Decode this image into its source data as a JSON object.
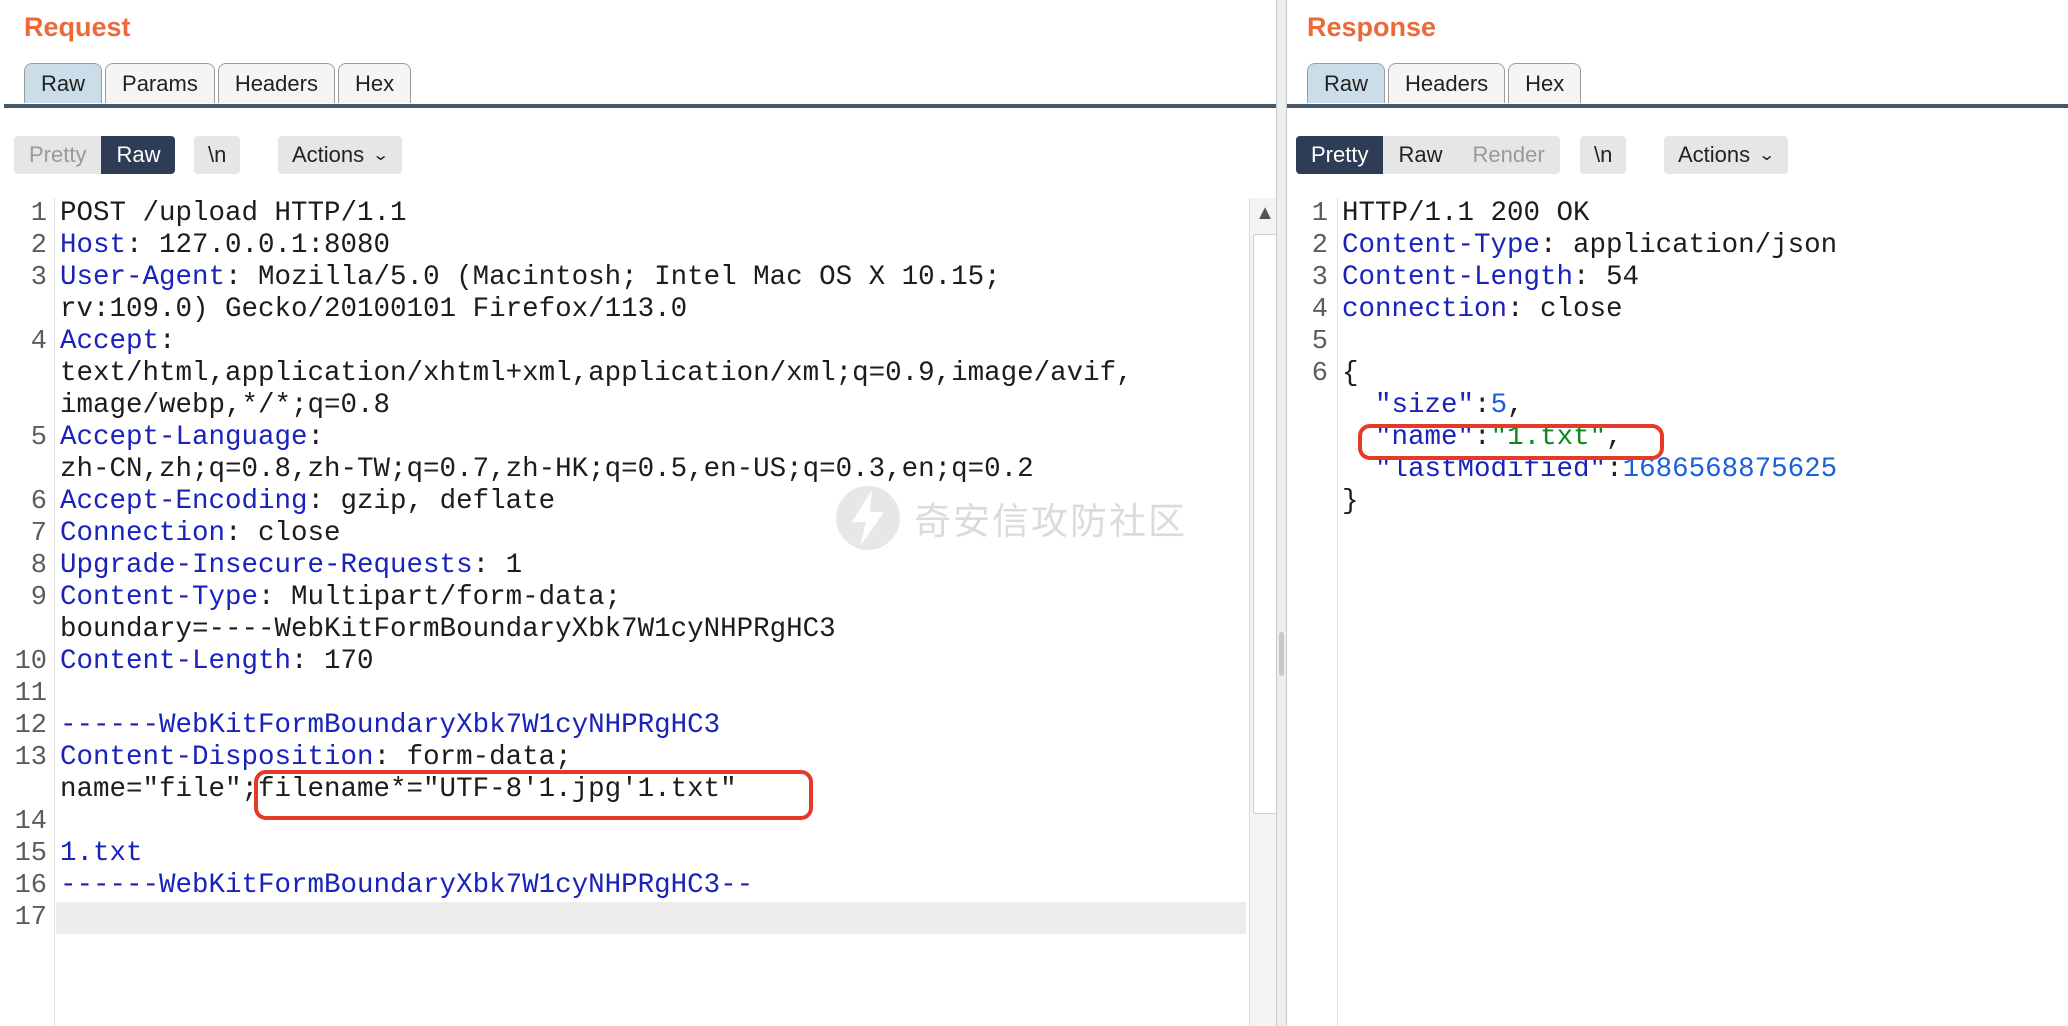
{
  "request": {
    "title": "Request",
    "tabs": [
      {
        "label": "Raw",
        "active": true
      },
      {
        "label": "Params",
        "active": false
      },
      {
        "label": "Headers",
        "active": false
      },
      {
        "label": "Hex",
        "active": false
      }
    ],
    "toolbar": {
      "pretty_label": "Pretty",
      "raw_label": "Raw",
      "active_view": "Raw",
      "newline_label": "\\n",
      "actions_label": "Actions"
    },
    "lines": [
      {
        "n": "1",
        "segments": [
          {
            "t": "POST /upload HTTP/1.1",
            "c": ""
          }
        ]
      },
      {
        "n": "2",
        "segments": [
          {
            "t": "Host",
            "c": "k"
          },
          {
            "t": ": 127.0.0.1:8080",
            "c": ""
          }
        ]
      },
      {
        "n": "3",
        "segments": [
          {
            "t": "User-Agent",
            "c": "k"
          },
          {
            "t": ": Mozilla/5.0 (Macintosh; Intel Mac OS X 10.15;",
            "c": ""
          }
        ]
      },
      {
        "n": "",
        "segments": [
          {
            "t": "rv:109.0) Gecko/20100101 Firefox/113.0",
            "c": ""
          }
        ]
      },
      {
        "n": "4",
        "segments": [
          {
            "t": "Accept",
            "c": "k"
          },
          {
            "t": ":",
            "c": ""
          }
        ]
      },
      {
        "n": "",
        "segments": [
          {
            "t": "text/html,application/xhtml+xml,application/xml;q=0.9,image/avif,",
            "c": ""
          }
        ]
      },
      {
        "n": "",
        "segments": [
          {
            "t": "image/webp,*/*;q=0.8",
            "c": ""
          }
        ]
      },
      {
        "n": "5",
        "segments": [
          {
            "t": "Accept-Language",
            "c": "k"
          },
          {
            "t": ":",
            "c": ""
          }
        ]
      },
      {
        "n": "",
        "segments": [
          {
            "t": "zh-CN,zh;q=0.8,zh-TW;q=0.7,zh-HK;q=0.5,en-US;q=0.3,en;q=0.2",
            "c": ""
          }
        ]
      },
      {
        "n": "6",
        "segments": [
          {
            "t": "Accept-Encoding",
            "c": "k"
          },
          {
            "t": ": gzip, deflate",
            "c": ""
          }
        ]
      },
      {
        "n": "7",
        "segments": [
          {
            "t": "Connection",
            "c": "k"
          },
          {
            "t": ": close",
            "c": ""
          }
        ]
      },
      {
        "n": "8",
        "segments": [
          {
            "t": "Upgrade-Insecure-Requests",
            "c": "k"
          },
          {
            "t": ": 1",
            "c": ""
          }
        ]
      },
      {
        "n": "9",
        "segments": [
          {
            "t": "Content-Type",
            "c": "k"
          },
          {
            "t": ": Multipart/form-data;",
            "c": ""
          }
        ]
      },
      {
        "n": "",
        "segments": [
          {
            "t": "boundary=----WebKitFormBoundaryXbk7W1cyNHPRgHC3",
            "c": ""
          }
        ]
      },
      {
        "n": "10",
        "segments": [
          {
            "t": "Content-Length",
            "c": "k"
          },
          {
            "t": ": 170",
            "c": ""
          }
        ]
      },
      {
        "n": "11",
        "segments": [
          {
            "t": "",
            "c": ""
          }
        ]
      },
      {
        "n": "12",
        "segments": [
          {
            "t": "------WebKitFormBoundaryXbk7W1cyNHPRgHC3",
            "c": "b"
          }
        ]
      },
      {
        "n": "13",
        "segments": [
          {
            "t": "Content-Disposition",
            "c": "k"
          },
          {
            "t": ": form-data;",
            "c": ""
          }
        ]
      },
      {
        "n": "",
        "segments": [
          {
            "t": "name=\"file\";filename*=\"UTF-8'1.jpg'1.txt\"",
            "c": ""
          }
        ]
      },
      {
        "n": "14",
        "segments": [
          {
            "t": "",
            "c": ""
          }
        ]
      },
      {
        "n": "15",
        "segments": [
          {
            "t": "1.txt",
            "c": "b"
          }
        ]
      },
      {
        "n": "16",
        "segments": [
          {
            "t": "------WebKitFormBoundaryXbk7W1cyNHPRgHC3--",
            "c": "b"
          }
        ]
      },
      {
        "n": "17",
        "segments": [
          {
            "t": "",
            "c": ""
          }
        ]
      }
    ]
  },
  "response": {
    "title": "Response",
    "tabs": [
      {
        "label": "Raw",
        "active": true
      },
      {
        "label": "Headers",
        "active": false
      },
      {
        "label": "Hex",
        "active": false
      }
    ],
    "toolbar": {
      "pretty_label": "Pretty",
      "raw_label": "Raw",
      "render_label": "Render",
      "active_view": "Pretty",
      "newline_label": "\\n",
      "actions_label": "Actions"
    },
    "lines": [
      {
        "n": "1",
        "segments": [
          {
            "t": "HTTP/1.1 200 OK",
            "c": ""
          }
        ]
      },
      {
        "n": "2",
        "segments": [
          {
            "t": "Content-Type",
            "c": "k"
          },
          {
            "t": ": application/json",
            "c": ""
          }
        ]
      },
      {
        "n": "3",
        "segments": [
          {
            "t": "Content-Length",
            "c": "k"
          },
          {
            "t": ": 54",
            "c": ""
          }
        ]
      },
      {
        "n": "4",
        "segments": [
          {
            "t": "connection",
            "c": "k"
          },
          {
            "t": ": close",
            "c": ""
          }
        ]
      },
      {
        "n": "5",
        "segments": [
          {
            "t": "",
            "c": ""
          }
        ]
      },
      {
        "n": "6",
        "segments": [
          {
            "t": "{",
            "c": ""
          }
        ]
      },
      {
        "n": "",
        "segments": [
          {
            "t": "  ",
            "c": ""
          },
          {
            "t": "\"size\"",
            "c": "jk"
          },
          {
            "t": ":",
            "c": ""
          },
          {
            "t": "5",
            "c": "jn"
          },
          {
            "t": ",",
            "c": ""
          }
        ]
      },
      {
        "n": "",
        "segments": [
          {
            "t": "  ",
            "c": ""
          },
          {
            "t": "\"name\"",
            "c": "jk"
          },
          {
            "t": ":",
            "c": ""
          },
          {
            "t": "\"1.txt\"",
            "c": "js"
          },
          {
            "t": ",",
            "c": ""
          }
        ]
      },
      {
        "n": "",
        "segments": [
          {
            "t": "  ",
            "c": ""
          },
          {
            "t": "\"lastModified\"",
            "c": "jk"
          },
          {
            "t": ":",
            "c": ""
          },
          {
            "t": "1686568875625",
            "c": "jn"
          }
        ]
      },
      {
        "n": "",
        "segments": [
          {
            "t": "}",
            "c": ""
          }
        ]
      }
    ]
  },
  "watermark": {
    "text": "奇安信攻防社区"
  },
  "colors": {
    "title_orange": "#ec6a3a",
    "header_key_blue": "#1a23b9",
    "json_string_green": "#0a8a1c",
    "json_number_blue": "#1a60d8",
    "highlight_box_red": "#e33a2a",
    "active_toggle_navy": "#2e3c56",
    "active_tab_blue": "#cbdde9"
  }
}
